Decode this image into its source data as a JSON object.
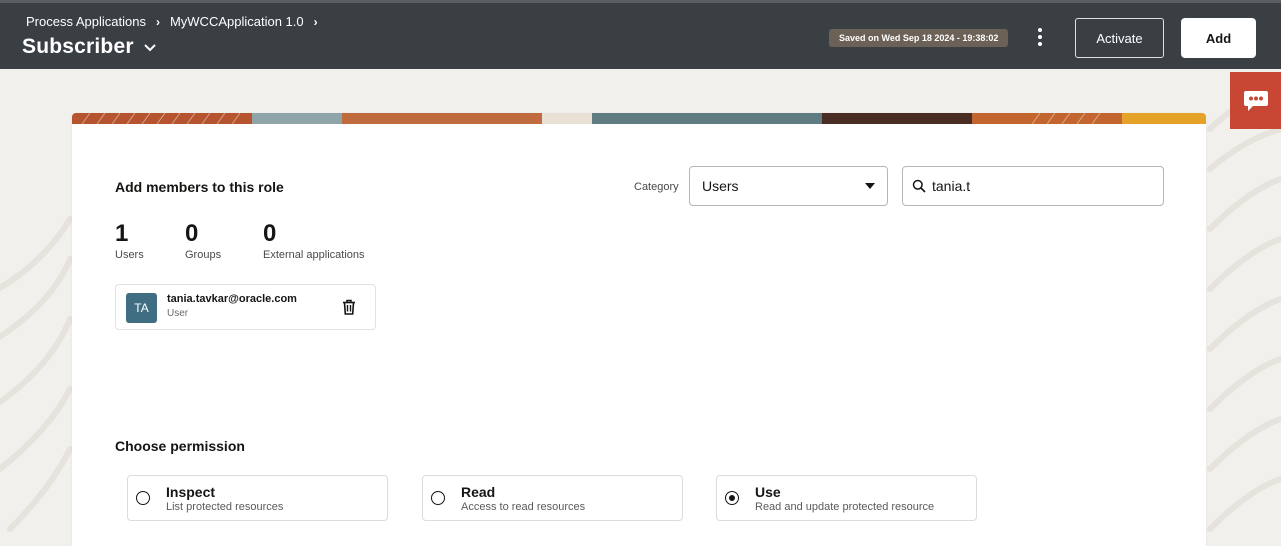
{
  "header": {
    "breadcrumb": [
      "Process Applications",
      "MyWCCApplication 1.0"
    ],
    "title": "Subscriber",
    "saved_text": "Saved on Wed Sep 18 2024 - 19:38:02",
    "activate_label": "Activate",
    "add_label": "Add"
  },
  "chat": {
    "icon": "chat-bubble-icon",
    "color": "#c74634"
  },
  "members": {
    "title": "Add members to this role",
    "category_label": "Category",
    "category_value": "Users",
    "search_value": "tania.t",
    "counts": [
      {
        "value": "1",
        "label": "Users"
      },
      {
        "value": "0",
        "label": "Groups"
      },
      {
        "value": "0",
        "label": "External applications"
      }
    ],
    "selected": [
      {
        "initials": "TA",
        "email": "tania.tavkar@oracle.com",
        "type": "User"
      }
    ]
  },
  "permission": {
    "title": "Choose permission",
    "options": [
      {
        "label": "Inspect",
        "description": "List protected resources",
        "selected": false
      },
      {
        "label": "Read",
        "description": "Access to read resources",
        "selected": false
      },
      {
        "label": "Use",
        "description": "Read and update protected resource",
        "selected": true
      }
    ]
  },
  "colors": {
    "header_bg": "#3a3f44",
    "accent_red": "#c74634",
    "avatar_bg": "#3f6e82",
    "saved_badge_bg": "#6b6157"
  }
}
